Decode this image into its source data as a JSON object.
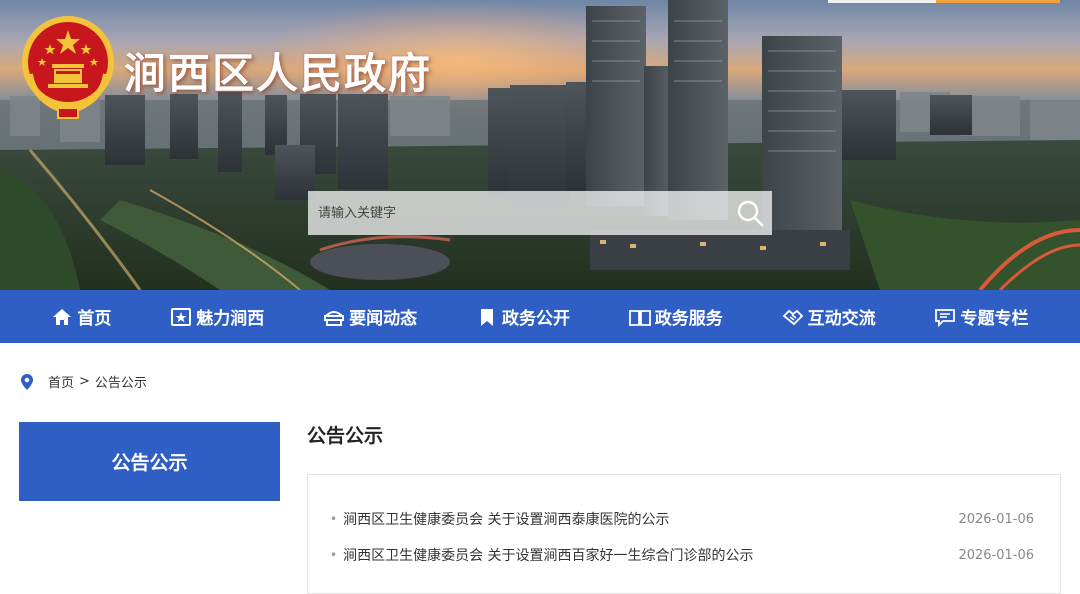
{
  "site": {
    "title": "涧西区人民政府"
  },
  "search": {
    "placeholder": "请输入关键字"
  },
  "nav": {
    "items": [
      {
        "label": "首页",
        "icon": "home-icon"
      },
      {
        "label": "魅力涧西",
        "icon": "star-icon"
      },
      {
        "label": "要闻动态",
        "icon": "news-icon"
      },
      {
        "label": "政务公开",
        "icon": "bookmark-icon"
      },
      {
        "label": "政务服务",
        "icon": "book-icon"
      },
      {
        "label": "互动交流",
        "icon": "handshake-icon"
      },
      {
        "label": "专题专栏",
        "icon": "chat-icon"
      }
    ]
  },
  "breadcrumb": {
    "home": "首页",
    "separator": ">",
    "current": "公告公示"
  },
  "sidebar": {
    "title": "公告公示"
  },
  "main": {
    "title": "公告公示",
    "list": [
      {
        "title": "涧西区卫生健康委员会 关于设置涧西泰康医院的公示",
        "date": "2026-01-06"
      },
      {
        "title": "涧西区卫生健康委员会 关于设置涧西百家好一生综合门诊部的公示",
        "date": "2026-01-06"
      }
    ]
  },
  "colors": {
    "primary": "#2f5fc4",
    "title_text": "#ffffff",
    "emblem_red": "#c8161d",
    "emblem_gold": "#f3c43a"
  }
}
